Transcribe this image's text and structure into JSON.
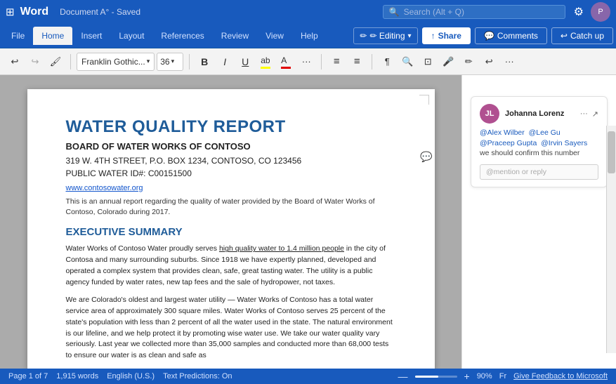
{
  "app": {
    "name": "Word",
    "doc_title": "Document A° - Saved",
    "grid_icon": "⊞"
  },
  "search": {
    "placeholder": "Search (Alt + Q)"
  },
  "ribbon": {
    "tabs": [
      {
        "label": "File",
        "active": false
      },
      {
        "label": "Home",
        "active": true
      },
      {
        "label": "Insert",
        "active": false
      },
      {
        "label": "Layout",
        "active": false
      },
      {
        "label": "References",
        "active": false
      },
      {
        "label": "Review",
        "active": false
      },
      {
        "label": "View",
        "active": false
      },
      {
        "label": "Help",
        "active": false
      }
    ],
    "editing_label": "✏ Editing",
    "share_label": "Share",
    "comments_label": "Comments",
    "catchup_label": "Catch up"
  },
  "toolbar": {
    "undo": "↩",
    "redo": "↪",
    "format_painter": "🖌",
    "font_name": "Franklin Gothic...",
    "font_size": "36",
    "bold": "B",
    "italic": "I",
    "underline": "U",
    "highlight": "ab",
    "font_color": "A",
    "more": "···",
    "bullets": "≡",
    "numbering": "≡",
    "paragraph": "¶",
    "find": "🔍",
    "view_mode": "⊡",
    "dictate": "🎤",
    "editor": "✏",
    "reuse": "↩",
    "more2": "···"
  },
  "document": {
    "title": "WATER QUALITY REPORT",
    "subtitle": "BOARD OF WATER WORKS OF CONTOSO",
    "address": "319 W. 4TH STREET, P.O. BOX 1234, CONTOSO, CO 123456",
    "water_id": "PUBLIC WATER ID#: C00151500",
    "link": "www.contosowater.org",
    "intro": "This is an annual report regarding the quality of water provided by the Board of Water Works of Contoso, Colorado during 2017.",
    "section1_title": "EXECUTIVE SUMMARY",
    "section1_p1": "Water Works of Contoso Water proudly serves high quality water to 1.4 million people in the city of Contosa and many surrounding suburbs. Since 1918 we have expertly planned, developed and operated a complex system that provides clean, safe, great tasting water. The utility is a public agency funded by water rates, new tap fees and the sale of hydropower, not taxes.",
    "section1_p2": "We are Colorado's oldest and largest water utility — Water Works of Contoso has a total water service area of approximately 300 square miles. Water Works of Contoso serves 25 percent of the state's population with less than 2 percent of all the water used in the state. The natural environment is our lifeline, and we help protect it by promoting wise water use. We take our water quality vary seriously. Last year we collected more than 35,000 samples and conducted more than 68,000 tests to ensure our water is as clean and safe as"
  },
  "comment": {
    "author": "Johanna Lorenz",
    "avatar_initials": "JL",
    "text": "@Alex Wilber  @Lee Gu\n@Praceep Gupta  @Irvin Sayers\nwe should confirm this number",
    "reply_placeholder": "@mention or reply",
    "mention1": "@Alex Wilber",
    "mention2": "@Lee Gu",
    "mention3": "@Praceep Gupta",
    "mention4": "@Irvin Sayers",
    "body": "we should confirm this number"
  },
  "status_bar": {
    "page": "Page 1 of 7",
    "words": "1,915 words",
    "language": "English (U.S.)",
    "text_predictions": "Text Predictions: On",
    "zoom": "90%",
    "fr": "Fr",
    "feedback": "Give Feedback to Microsoft"
  }
}
